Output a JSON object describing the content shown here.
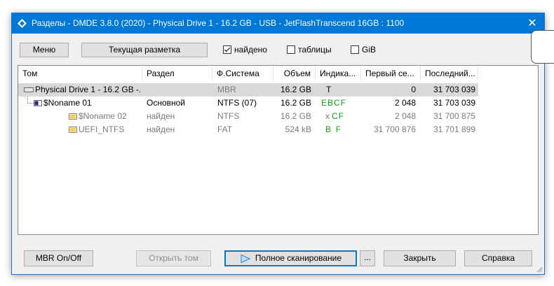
{
  "window": {
    "title": "Разделы - DMDE 3.8.0 (2020) - Physical Drive 1 - 16.2 GB - USB - JetFlashTranscend 16GB : 1100",
    "close_glyph": "✕"
  },
  "toolbar": {
    "menu_label": "Меню",
    "current_layout_label": "Текущая разметка",
    "found_label": "найдено",
    "found_checked": true,
    "tables_label": "таблицы",
    "tables_checked": false,
    "gib_label": "GiB",
    "gib_checked": false
  },
  "columns": [
    "Том",
    "Раздел",
    "Ф.Система",
    "Объем",
    "Индика...",
    "Первый се...",
    "Последний..."
  ],
  "rows": [
    {
      "name": "Physical Drive 1 - 16.2 GB -...",
      "partition": "",
      "fs": "MBR",
      "size": "16.2 GB",
      "ind": "T",
      "first": "0",
      "last": "31 703 039",
      "selected": true
    },
    {
      "name": "$Noname 01",
      "partition": "Основной",
      "fs": "NTFS (07)",
      "size": "16.2 GB",
      "ind": "EBCF",
      "first": "2 048",
      "last": "31 703 039"
    },
    {
      "name": "$Noname 02",
      "partition": "найден",
      "fs": "NTFS",
      "size": "16.2 GB",
      "ind_prefix": "x",
      "ind": "CF",
      "first": "2 048",
      "last": "31 700 875"
    },
    {
      "name": "UEFI_NTFS",
      "partition": "найден",
      "fs": "FAT",
      "size": "524 kB",
      "ind": "B  F",
      "first": "31 700 876",
      "last": "31 701 899"
    }
  ],
  "buttons": {
    "mbr": "MBR On/Off",
    "open_volume": "Открыть том",
    "full_scan": "Полное сканирование",
    "more": "...",
    "close": "Закрыть",
    "help": "Справка"
  },
  "colors": {
    "titlebar": "#0078d7",
    "indicator_green": "#18a018",
    "selection": "#d9d9d9"
  },
  "icons": [
    "app-icon",
    "close-icon",
    "drive-icon",
    "partition-icon",
    "play-icon"
  ]
}
